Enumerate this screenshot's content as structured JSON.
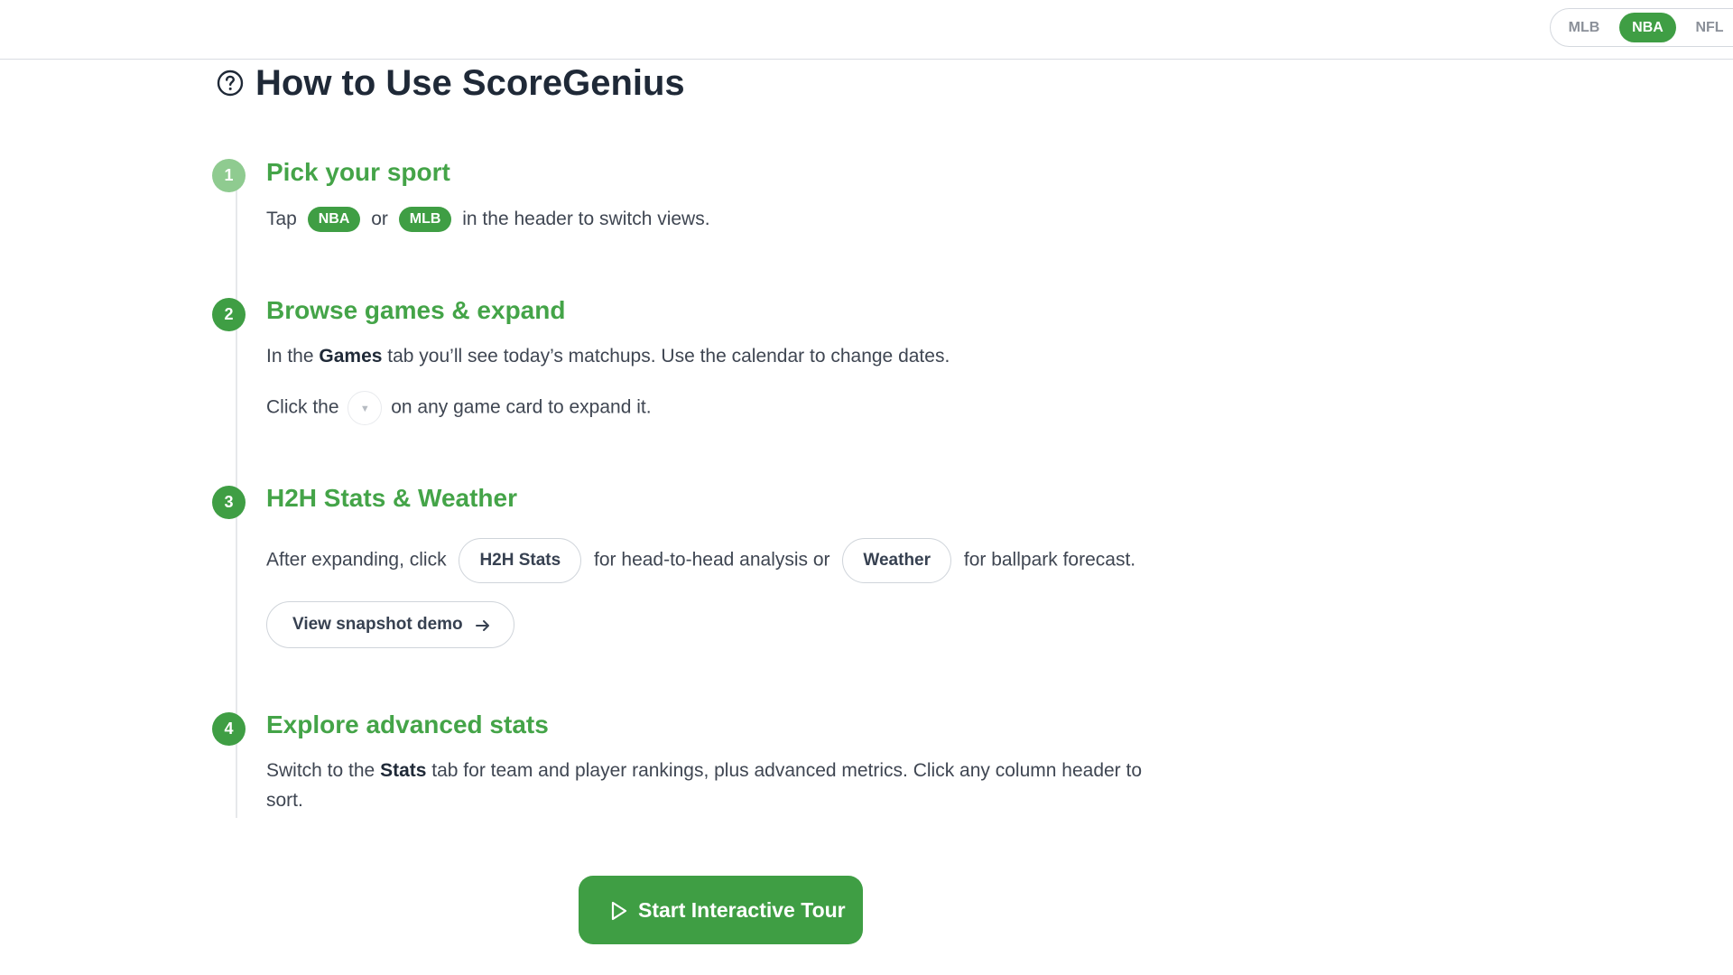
{
  "header": {
    "sports": [
      "MLB",
      "NBA",
      "NFL"
    ],
    "active_sport": "NBA"
  },
  "page": {
    "title": "How to Use ScoreGenius"
  },
  "steps": [
    {
      "number": "1",
      "title": "Pick your sport",
      "text_before": "Tap",
      "pill_a": "NBA",
      "text_mid": "or",
      "pill_b": "MLB",
      "text_after": "in the header to switch views."
    },
    {
      "number": "2",
      "title": "Browse games & expand",
      "line1_before": "In the",
      "line1_bold": "Games",
      "line1_after": "tab you’ll see today’s matchups. Use the calendar to change dates.",
      "line2_before": "Click the",
      "line2_after": "on any game card to expand it.",
      "chevron_icon": "chevron-down-icon"
    },
    {
      "number": "3",
      "title": "H2H Stats & Weather",
      "text_before": "After expanding, click",
      "button_a": "H2H Stats",
      "text_mid": "for head-to-head analysis or",
      "button_b": "Weather",
      "text_after": "for ballpark forecast.",
      "demo_button": "View snapshot demo"
    },
    {
      "number": "4",
      "title": "Explore advanced stats",
      "line1_before": "Switch to the",
      "line1_bold": "Stats",
      "line1_after": "tab for team and player rankings, plus advanced metrics. Click any column header to",
      "line2": "sort."
    }
  ],
  "cta": {
    "label": "Start Interactive Tour"
  },
  "colors": {
    "accent": "#3f9e44",
    "accent_light": "#8fcb90",
    "title_green": "#44a448"
  }
}
